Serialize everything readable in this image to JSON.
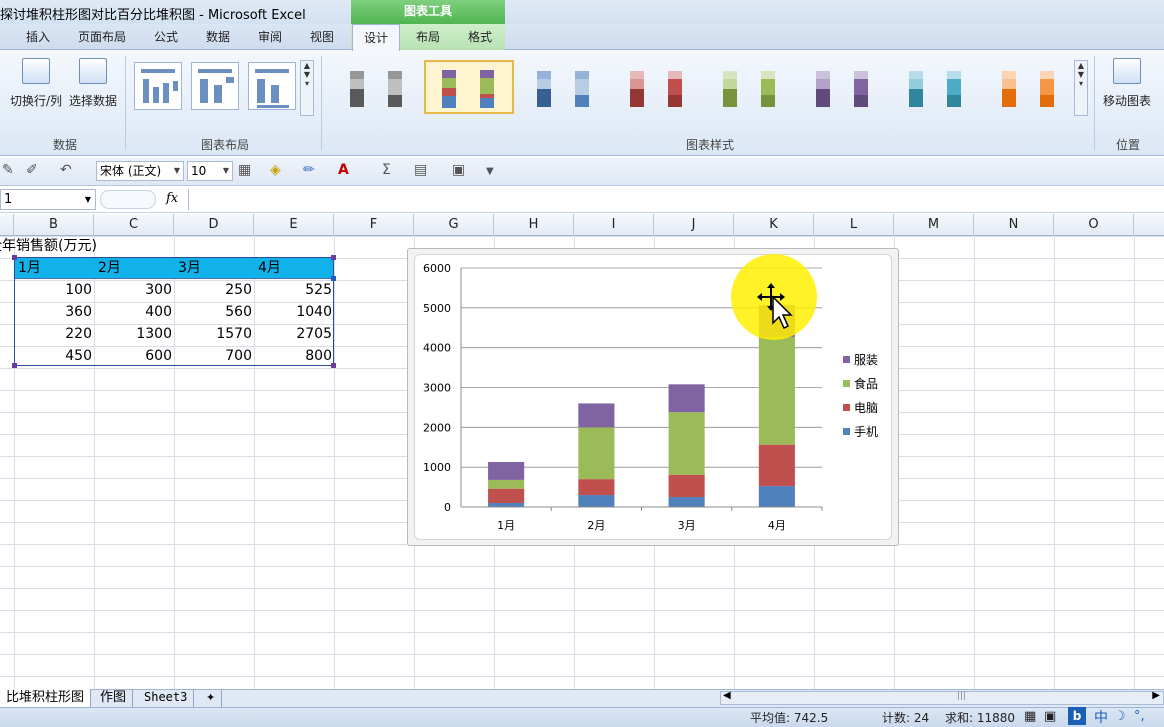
{
  "window": {
    "title": "探讨堆积柱形图对比百分比堆积图 - Microsoft Excel",
    "context_tab": "图表工具"
  },
  "tabs": [
    "插入",
    "页面布局",
    "公式",
    "数据",
    "审阅",
    "视图",
    "设计",
    "布局",
    "格式"
  ],
  "ribbon": {
    "switch_row_col": "切换行/列",
    "select_data": "选择数据",
    "group_data": "数据",
    "group_layout": "图表布局",
    "group_styles": "图表样式",
    "move_chart": "移动图表",
    "group_location": "位置"
  },
  "toolbar": {
    "font_name": "宋体 (正文)",
    "font_size": "10"
  },
  "formula_bar": {
    "name_box": "1",
    "fx": "fx",
    "formula": ""
  },
  "columns": [
    "B",
    "C",
    "D",
    "E",
    "F",
    "G",
    "H",
    "I",
    "J",
    "K",
    "L",
    "M",
    "N",
    "O"
  ],
  "sheet": {
    "title": "全年销售额(万元)",
    "headers": [
      "1月",
      "2月",
      "3月",
      "4月"
    ],
    "rows": [
      [
        "100",
        "300",
        "250",
        "525"
      ],
      [
        "360",
        "400",
        "560",
        "1040"
      ],
      [
        "220",
        "1300",
        "1570",
        "2705"
      ],
      [
        "450",
        "600",
        "700",
        "800"
      ]
    ]
  },
  "chart_data": {
    "type": "bar",
    "stacked": true,
    "categories": [
      "1月",
      "2月",
      "3月",
      "4月"
    ],
    "series": [
      {
        "name": "手机",
        "values": [
          100,
          300,
          250,
          525
        ],
        "color": "#4f81bd"
      },
      {
        "name": "电脑",
        "values": [
          360,
          400,
          560,
          1040
        ],
        "color": "#c0504d"
      },
      {
        "name": "食品",
        "values": [
          220,
          1300,
          1570,
          2705
        ],
        "color": "#9bbb59"
      },
      {
        "name": "服装",
        "values": [
          450,
          600,
          700,
          800
        ],
        "color": "#8064a2"
      }
    ],
    "yticks": [
      "0",
      "1000",
      "2000",
      "3000",
      "4000",
      "5000",
      "6000"
    ],
    "ylim": [
      0,
      6000
    ],
    "grid": true,
    "legend_position": "right"
  },
  "sheet_tabs": [
    "比堆积柱形图",
    "作图",
    "Sheet3"
  ],
  "status": {
    "average": "平均值: 742.5",
    "count": "计数: 24",
    "sum": "求和: 11880",
    "ime": "中"
  }
}
